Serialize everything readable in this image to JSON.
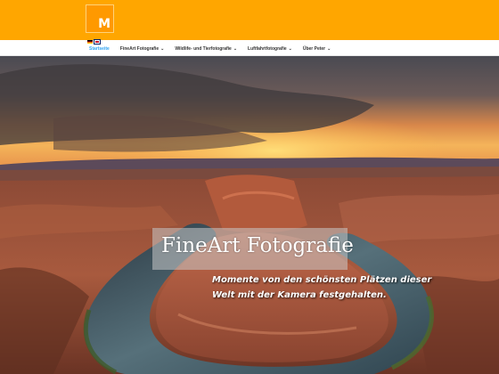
{
  "header": {
    "logo_letter": "M",
    "brand_color": "#ffa600"
  },
  "nav": {
    "flags": [
      "flag-de-icon",
      "flag-en-icon"
    ],
    "items": [
      {
        "label": "Startseite",
        "active": true,
        "has_dropdown": false
      },
      {
        "label": "FineArt Fotografie",
        "active": false,
        "has_dropdown": true
      },
      {
        "label": "Wildlife- und Tierfotografie",
        "active": false,
        "has_dropdown": true
      },
      {
        "label": "Luftfahrtfotografie",
        "active": false,
        "has_dropdown": true
      },
      {
        "label": "Über Peter",
        "active": false,
        "has_dropdown": true
      }
    ],
    "active_color": "#2ea3f2",
    "dropdown_glyph": "⌄"
  },
  "hero": {
    "title": "FineArt Fotografie",
    "subtitle": "Momente von den schönsten Plätzen dieser Welt mit der Kamera festgehalten."
  }
}
